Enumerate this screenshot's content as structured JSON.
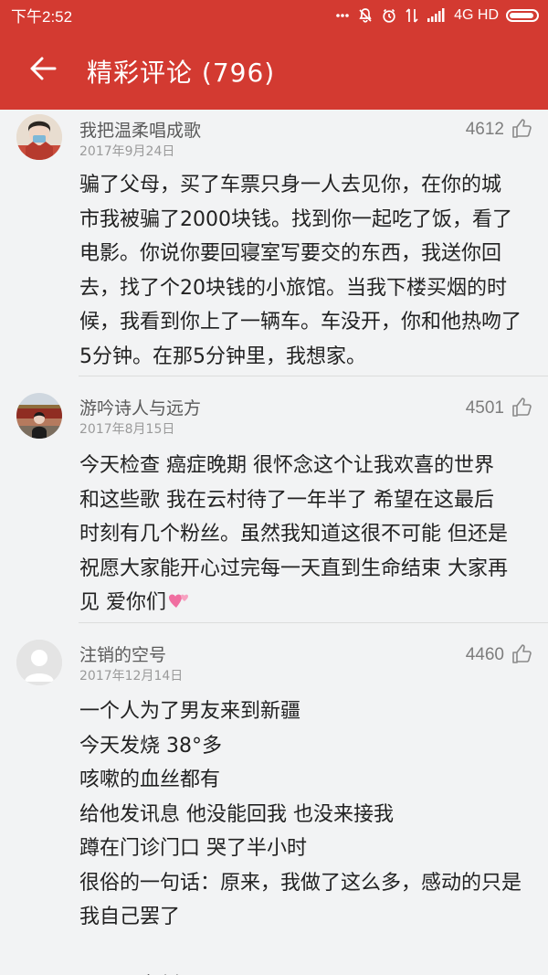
{
  "status_bar": {
    "time": "下午2:52",
    "network": "4G HD"
  },
  "toolbar": {
    "title": "精彩评论 (796)"
  },
  "comments": [
    {
      "user": "我把温柔唱成歌",
      "date": "2017年9月24日",
      "likes": "4612",
      "text": "骗了父母，买了车票只身一人去见你，在你的城\n市我被骗了2000块钱。找到你一起吃了饭，看了\n电影。你说你要回寝室写要交的东西，我送你回\n去，找了个20块钱的小旅馆。当我下楼买烟的时\n候，我看到你上了一辆车。车没开，你和他热吻了\n5分钟。在那5分钟里，我想家。"
    },
    {
      "user": "游吟诗人与远方",
      "date": "2017年8月15日",
      "likes": "4501",
      "text": "今天检查 癌症晚期 很怀念这个让我欢喜的世界\n和这些歌 我在云村待了一年半了 希望在这最后\n时刻有几个粉丝。虽然我知道这很不可能 但还是\n祝愿大家能开心过完每一天直到生命结束 大家再\n见 爱你们"
    },
    {
      "user": "注销的空号",
      "date": "2017年12月14日",
      "likes": "4460",
      "text": "一个人为了男友来到新疆\n今天发烧 38°多\n咳嗽的血丝都有\n给他发讯息 他没能回我 也没来接我\n蹲在门诊门口 哭了半小时\n很俗的一句话：原来，我做了这么多，感动的只是\n我自己罢了\n\n明天回台州"
    }
  ],
  "icons": {
    "back": "arrow-left-icon",
    "like": "thumbs-up-icon",
    "emoji": "two-hearts-icon"
  },
  "colors": {
    "header": "#d33a31",
    "background": "#f2f3f4"
  }
}
